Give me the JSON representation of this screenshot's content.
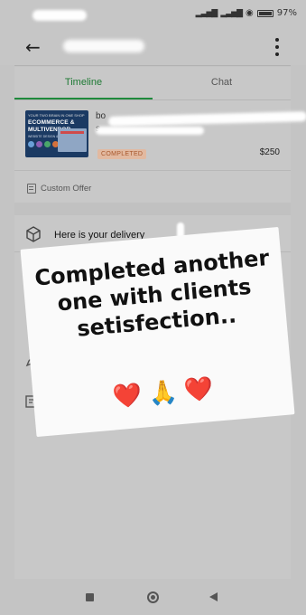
{
  "status_bar": {
    "battery": "97%",
    "icons": [
      "signal-icon",
      "wifi-icon",
      "battery-icon"
    ]
  },
  "app_bar": {
    "back_icon": "arrow-left-icon",
    "more_icon": "more-vertical-icon"
  },
  "tabs": [
    {
      "label": "Timeline",
      "active": true
    },
    {
      "label": "Chat",
      "active": false
    }
  ],
  "order": {
    "title_prefix": "bo",
    "subtitle_prefix": "s",
    "thumbnail": {
      "top_text": "YOUR TWO BRAIN IN ONE SHOP",
      "line1": "ECOMMERCE &",
      "line2": "MULTIVENDOR",
      "sub": "WEBSITE DESIGN & DEVELOPMENT"
    },
    "status": "COMPLETED",
    "price": "$250"
  },
  "custom_offer": {
    "label": "Custom Offer",
    "icon": "document-icon"
  },
  "delivery": {
    "title": "Here is your delivery",
    "icon": "package-icon",
    "chevron": "chevron-down-icon"
  },
  "note": {
    "text": "Completed another one with clients setisfection..",
    "emoji": [
      "❤️",
      "🙏",
      "❤️"
    ]
  },
  "colors": {
    "accent": "#1f8a3c",
    "badge_bg": "#e2b9a0",
    "badge_text": "#a8572b"
  }
}
